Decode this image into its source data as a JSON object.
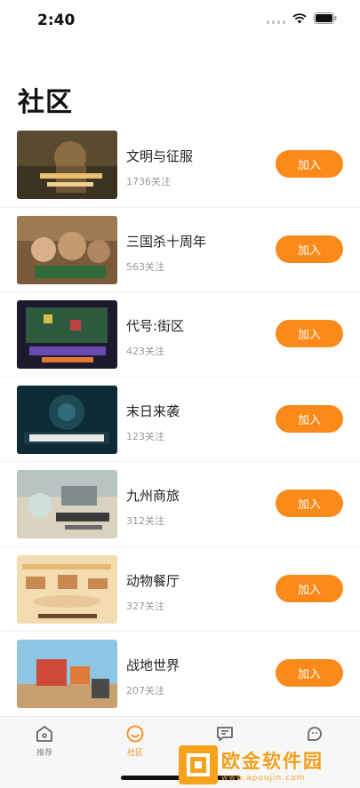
{
  "status_bar": {
    "time": "2:40"
  },
  "page": {
    "title": "社区"
  },
  "communities": [
    {
      "name": "文明与征服",
      "follows": "1736关注",
      "join_label": "加入"
    },
    {
      "name": "三国杀十周年",
      "follows": "563关注",
      "join_label": "加入"
    },
    {
      "name": "代号:街区",
      "follows": "423关注",
      "join_label": "加入"
    },
    {
      "name": "末日来袭",
      "follows": "123关注",
      "join_label": "加入"
    },
    {
      "name": "九州商旅",
      "follows": "312关注",
      "join_label": "加入"
    },
    {
      "name": "动物餐厅",
      "follows": "327关注",
      "join_label": "加入"
    },
    {
      "name": "战地世界",
      "follows": "207关注",
      "join_label": "加入"
    }
  ],
  "tabbar": {
    "tabs": [
      {
        "label": "推荐",
        "icon": "home-icon",
        "active": false
      },
      {
        "label": "社区",
        "icon": "smile-icon",
        "active": true
      },
      {
        "label": "",
        "icon": "message-icon",
        "active": false
      },
      {
        "label": "",
        "icon": "profile-icon",
        "active": false
      }
    ]
  },
  "watermark": {
    "main": "欧金软件园",
    "sub": "www.apoujin.com"
  },
  "colors": {
    "accent": "#fb8a1a",
    "text": "#222222",
    "subtext": "#999999"
  }
}
